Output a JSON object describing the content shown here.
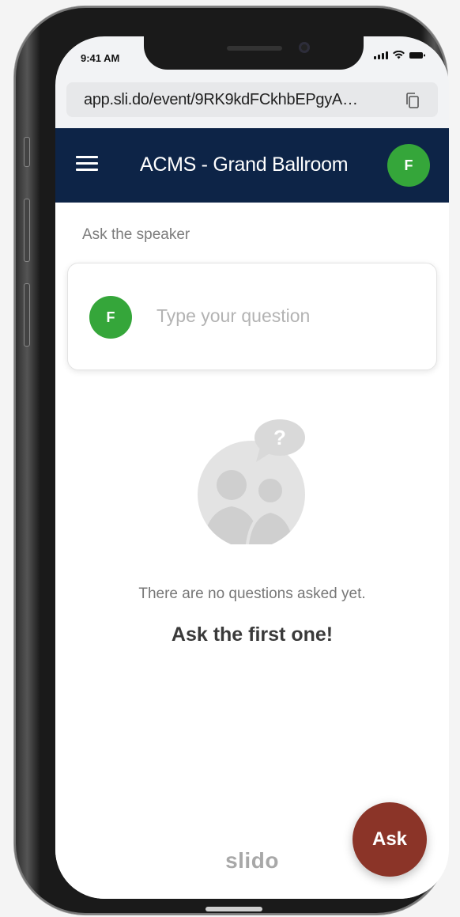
{
  "status_bar": {
    "time": "9:41 AM"
  },
  "browser": {
    "url": "app.sli.do/event/9RK9kdFCkhbEPgyA…"
  },
  "header": {
    "title": "ACMS - Grand Ballroom",
    "avatar_initial": "F"
  },
  "ask_section": {
    "label": "Ask the speaker",
    "avatar_initial": "F",
    "placeholder": "Type your question"
  },
  "empty_state": {
    "message": "There are no questions asked yet.",
    "cta": "Ask the first one!",
    "bubble_symbol": "?"
  },
  "footer": {
    "brand": "slido",
    "ask_button_label": "Ask"
  },
  "colors": {
    "header_bg": "#0d2447",
    "avatar_green": "#35a63a",
    "ask_button": "#8b3428"
  }
}
